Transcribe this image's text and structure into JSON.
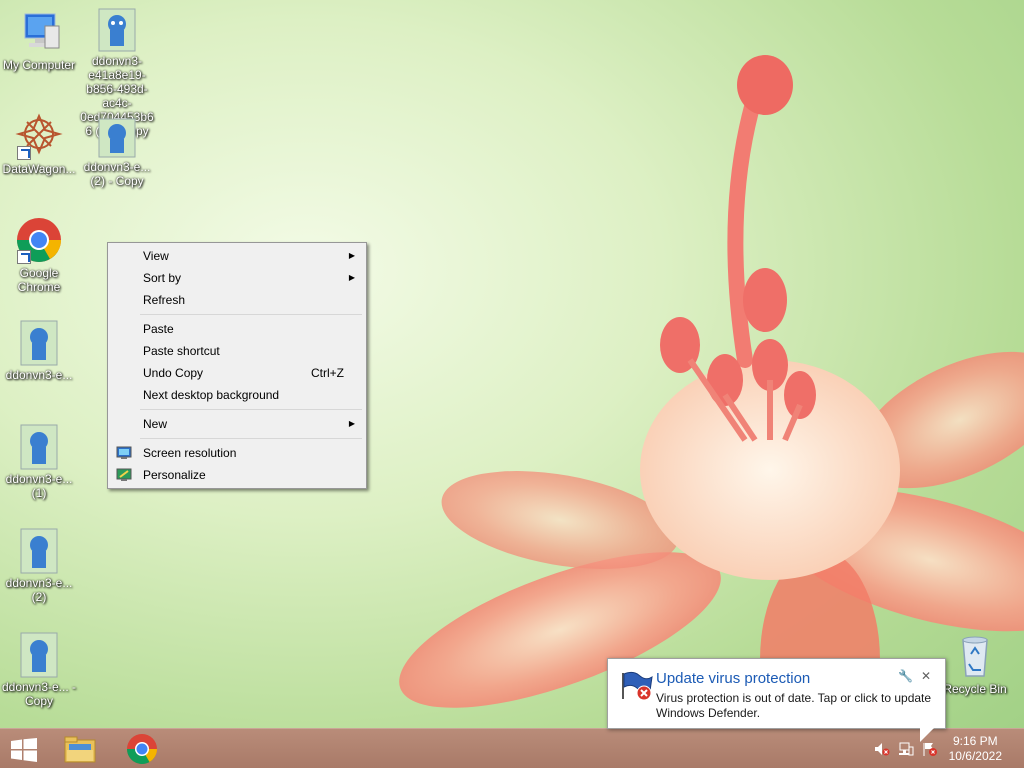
{
  "desktop": {
    "icons": [
      {
        "label": "My Computer",
        "icon": "computer-icon"
      },
      {
        "label": "ddonvn3-e41a8e19-b856-493d-ac4c-0ed704453b66 (1) - Copy",
        "icon": "ddonvn3-image-icon"
      },
      {
        "label": "DataWagon...",
        "icon": "datawagon-icon"
      },
      {
        "label": "ddonvn3-e... (2) - Copy",
        "icon": "ddonvn3-image-icon"
      },
      {
        "label": "Google Chrome",
        "icon": "chrome-icon"
      },
      {
        "label": "ddonvn3-e...",
        "icon": "ddonvn3-image-icon"
      },
      {
        "label": "ddonvn3-e... (1)",
        "icon": "ddonvn3-image-icon"
      },
      {
        "label": "ddonvn3-e... (2)",
        "icon": "ddonvn3-image-icon"
      },
      {
        "label": "ddonvn3-e... - Copy",
        "icon": "ddonvn3-image-icon"
      },
      {
        "label": "Recycle Bin",
        "icon": "recycle-bin-icon"
      }
    ]
  },
  "context_menu": {
    "items": [
      {
        "label": "View",
        "submenu": true
      },
      {
        "label": "Sort by",
        "submenu": true
      },
      {
        "label": "Refresh"
      },
      {
        "label": "Paste"
      },
      {
        "label": "Paste shortcut"
      },
      {
        "label": "Undo Copy",
        "shortcut": "Ctrl+Z"
      },
      {
        "label": "Next desktop background"
      },
      {
        "label": "New",
        "submenu": true
      },
      {
        "label": "Screen resolution",
        "icon": "monitor-icon"
      },
      {
        "label": "Personalize",
        "icon": "personalize-icon"
      }
    ]
  },
  "notification": {
    "title": "Update virus protection",
    "text": "Virus protection is out of date. Tap or click to update Windows Defender.",
    "icon": "defender-flag-icon"
  },
  "taskbar": {
    "apps": [
      {
        "name": "File Explorer",
        "icon": "file-explorer-icon"
      },
      {
        "name": "Google Chrome",
        "icon": "chrome-icon"
      }
    ],
    "tray": [
      "volume-muted-icon",
      "network-icon",
      "action-center-alert-icon"
    ],
    "clock": {
      "time": "9:16 PM",
      "date": "10/6/2022"
    }
  },
  "colors": {
    "taskbar": "#a97a68",
    "menu_bg": "#f0f0f0",
    "notification_title": "#1c5bb5"
  }
}
